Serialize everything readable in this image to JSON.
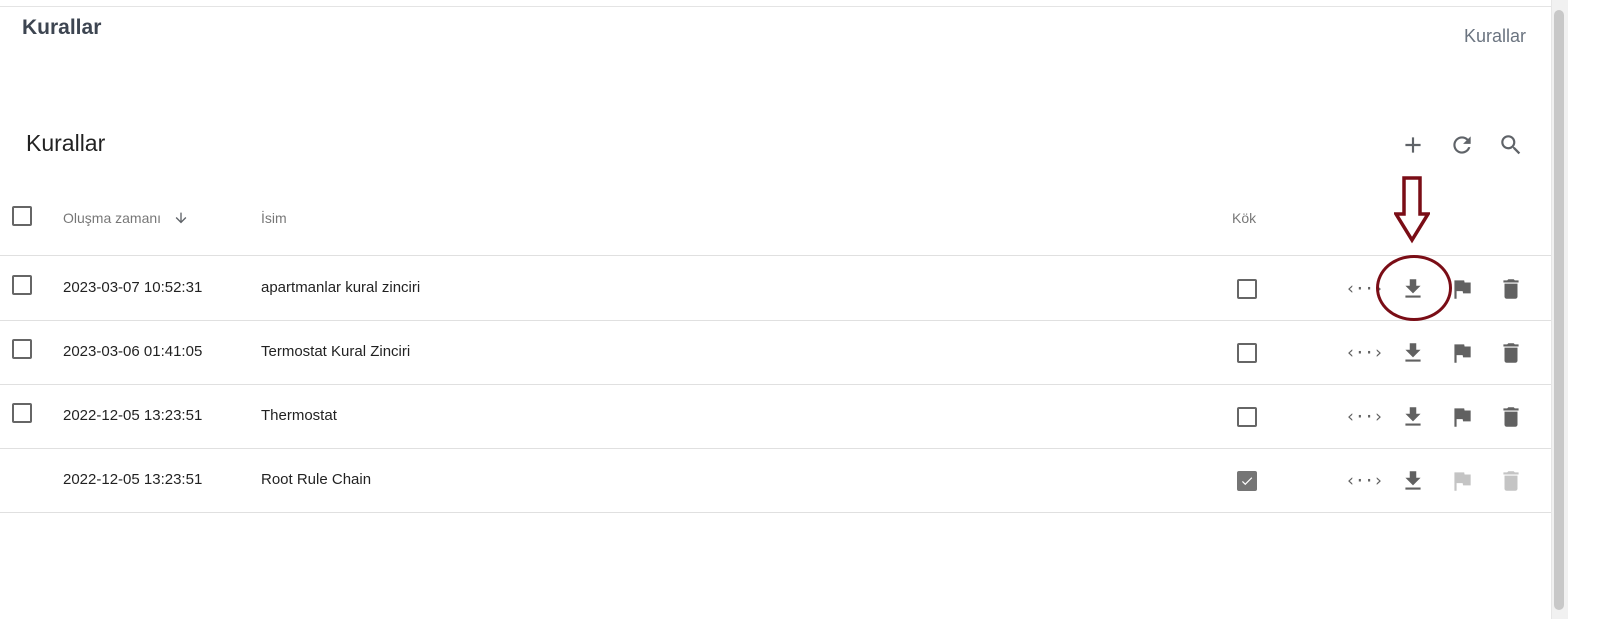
{
  "page": {
    "title": "Kurallar",
    "breadcrumb": "Kurallar"
  },
  "card": {
    "title": "Kurallar"
  },
  "toolbar": {
    "add_icon": "plus-icon",
    "refresh_icon": "refresh-icon",
    "search_icon": "search-icon"
  },
  "table": {
    "headers": {
      "created": "Oluşma zamanı",
      "name": "İsim",
      "root": "Kök"
    },
    "sort": {
      "column": "created",
      "direction": "desc",
      "icon": "arrow-down-icon"
    },
    "rows": [
      {
        "created": "2023-03-07 10:52:31",
        "name": "apartmanlar kural zinciri",
        "root": false,
        "selectable": true,
        "root_actions_enabled": true
      },
      {
        "created": "2023-03-06 01:41:05",
        "name": "Termostat Kural Zinciri",
        "root": false,
        "selectable": true,
        "root_actions_enabled": true
      },
      {
        "created": "2022-12-05 13:23:51",
        "name": "Thermostat",
        "root": false,
        "selectable": true,
        "root_actions_enabled": true
      },
      {
        "created": "2022-12-05 13:23:51",
        "name": "Root Rule Chain",
        "root": true,
        "selectable": false,
        "root_actions_enabled": false
      }
    ],
    "row_action_icons": [
      "code-braces-icon",
      "download-icon",
      "flag-icon",
      "delete-icon"
    ]
  },
  "annotation": {
    "color": "#7a0d16",
    "target": "download-icon (row 1)"
  }
}
